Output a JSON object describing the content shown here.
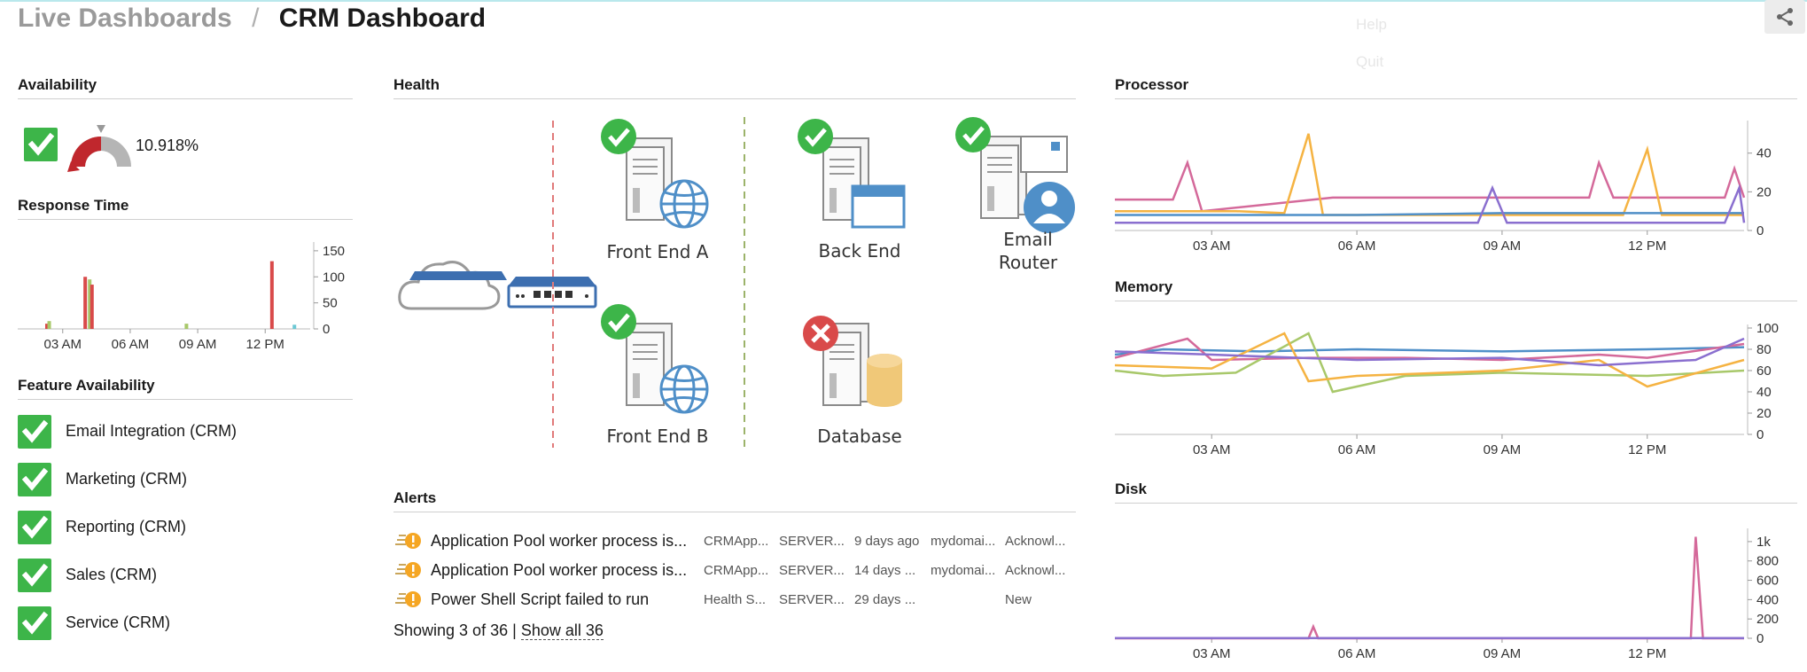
{
  "breadcrumb": {
    "root": "Live Dashboards",
    "separator": "/",
    "current": "CRM Dashboard"
  },
  "menu_ghost": {
    "help": "Help",
    "quit": "Quit"
  },
  "availability": {
    "title": "Availability",
    "value": "10.918%",
    "status_color": "#3db549",
    "gauge_color": "#c0272d"
  },
  "response_time": {
    "title": "Response Time"
  },
  "feature_availability": {
    "title": "Feature Availability",
    "items": [
      {
        "label": "Email Integration (CRM)"
      },
      {
        "label": "Marketing (CRM)"
      },
      {
        "label": "Reporting (CRM)"
      },
      {
        "label": "Sales (CRM)"
      },
      {
        "label": "Service (CRM)"
      }
    ]
  },
  "health": {
    "title": "Health",
    "nodes": [
      {
        "label": "Front End A",
        "status": "ok"
      },
      {
        "label": "Back End",
        "status": "ok"
      },
      {
        "label": "Email Router",
        "label_line1": "Email",
        "label_line2": "Router",
        "status": "ok"
      },
      {
        "label": "Front End B",
        "status": "ok"
      },
      {
        "label": "Database",
        "status": "error"
      }
    ]
  },
  "alerts": {
    "title": "Alerts",
    "rows": [
      {
        "name": "Application Pool worker process is...",
        "source": "CRMApp...",
        "server": "SERVER...",
        "age": "9 days ago",
        "domain": "mydomai...",
        "state": "Acknowl..."
      },
      {
        "name": "Application Pool worker process is...",
        "source": "CRMApp...",
        "server": "SERVER...",
        "age": "14 days ...",
        "domain": "mydomai...",
        "state": "Acknowl..."
      },
      {
        "name": "Power Shell Script failed to run",
        "source": "Health S...",
        "server": "SERVER...",
        "age": "29 days ...",
        "domain": "",
        "state": "New"
      }
    ],
    "showing_text": "Showing 3 of 36",
    "divider": "|",
    "show_all": "Show all 36"
  },
  "colors": {
    "pink": "#d4699a",
    "orange": "#f5b342",
    "blue": "#4f8fc8",
    "purple": "#8a6fcf",
    "green": "#a8c86a",
    "red": "#d94a4a"
  },
  "chart_data": [
    {
      "type": "bar",
      "title": "Response Time",
      "x_ticks": [
        "03 AM",
        "06 AM",
        "09 AM",
        "12 PM"
      ],
      "y_ticks": [
        "150",
        "100",
        "50",
        "0"
      ],
      "ylim": [
        0,
        160
      ],
      "x_range_hours": [
        1.0,
        14.0
      ],
      "series": [
        {
          "values": [
            [
              2.3,
              10
            ],
            [
              2.4,
              15
            ],
            [
              4.0,
              100
            ],
            [
              4.2,
              95
            ],
            [
              4.3,
              85
            ],
            [
              8.5,
              10
            ],
            [
              12.3,
              130
            ],
            [
              13.3,
              8
            ]
          ]
        }
      ]
    },
    {
      "type": "line",
      "title": "Processor",
      "x_ticks": [
        "03 AM",
        "06 AM",
        "09 AM",
        "12 PM"
      ],
      "y_ticks": [
        "40",
        "20",
        "0"
      ],
      "ylim": [
        0,
        55
      ],
      "x_range_hours": [
        1.0,
        14.0
      ],
      "series": [
        {
          "color": "#d4699a",
          "values": [
            [
              1.0,
              16
            ],
            [
              2.2,
              16
            ],
            [
              2.5,
              35
            ],
            [
              2.8,
              10
            ],
            [
              5.5,
              17
            ],
            [
              10.0,
              17
            ],
            [
              10.8,
              17
            ],
            [
              11.0,
              35
            ],
            [
              11.3,
              17
            ],
            [
              13.6,
              17
            ],
            [
              13.8,
              32
            ],
            [
              14.0,
              17
            ]
          ]
        },
        {
          "color": "#f5b342",
          "values": [
            [
              1.0,
              10
            ],
            [
              3.5,
              10
            ],
            [
              4.5,
              9
            ],
            [
              5.0,
              50
            ],
            [
              5.3,
              8
            ],
            [
              11.5,
              8
            ],
            [
              12.0,
              42
            ],
            [
              12.3,
              8
            ],
            [
              14.0,
              8
            ]
          ]
        },
        {
          "color": "#4f8fc8",
          "values": [
            [
              1.0,
              8
            ],
            [
              6.0,
              8
            ],
            [
              9.0,
              9
            ],
            [
              14.0,
              9
            ]
          ]
        },
        {
          "color": "#8a6fcf",
          "values": [
            [
              1.0,
              4
            ],
            [
              8.5,
              4
            ],
            [
              8.8,
              22
            ],
            [
              9.1,
              4
            ],
            [
              13.6,
              4
            ],
            [
              13.9,
              22
            ],
            [
              14.0,
              4
            ]
          ]
        }
      ]
    },
    {
      "type": "line",
      "title": "Memory",
      "x_ticks": [
        "03 AM",
        "06 AM",
        "09 AM",
        "12 PM"
      ],
      "y_ticks": [
        "100",
        "80",
        "60",
        "40",
        "20",
        "0"
      ],
      "ylim": [
        0,
        100
      ],
      "x_range_hours": [
        1.0,
        14.0
      ],
      "series": [
        {
          "color": "#4f8fc8",
          "values": [
            [
              1.0,
              75
            ],
            [
              2.0,
              80
            ],
            [
              4.0,
              78
            ],
            [
              6.0,
              80
            ],
            [
              9.0,
              78
            ],
            [
              12.0,
              80
            ],
            [
              14.0,
              82
            ]
          ]
        },
        {
          "color": "#d4699a",
          "values": [
            [
              1.0,
              72
            ],
            [
              2.5,
              90
            ],
            [
              3.0,
              70
            ],
            [
              5.0,
              72
            ],
            [
              7.0,
              72
            ],
            [
              9.0,
              70
            ],
            [
              11.0,
              75
            ],
            [
              12.0,
              72
            ],
            [
              14.0,
              85
            ]
          ]
        },
        {
          "color": "#a8c86a",
          "values": [
            [
              1.0,
              60
            ],
            [
              2.0,
              55
            ],
            [
              3.5,
              58
            ],
            [
              5.0,
              95
            ],
            [
              5.5,
              40
            ],
            [
              7.0,
              55
            ],
            [
              9.0,
              58
            ],
            [
              12.0,
              55
            ],
            [
              14.0,
              60
            ]
          ]
        },
        {
          "color": "#f5b342",
          "values": [
            [
              1.0,
              65
            ],
            [
              3.0,
              62
            ],
            [
              4.5,
              95
            ],
            [
              5.0,
              50
            ],
            [
              6.0,
              55
            ],
            [
              9.0,
              60
            ],
            [
              11.0,
              70
            ],
            [
              12.0,
              45
            ],
            [
              14.0,
              70
            ]
          ]
        },
        {
          "color": "#8a6fcf",
          "values": [
            [
              1.0,
              78
            ],
            [
              3.0,
              75
            ],
            [
              6.0,
              70
            ],
            [
              9.0,
              72
            ],
            [
              11.0,
              65
            ],
            [
              13.0,
              70
            ],
            [
              14.0,
              90
            ]
          ]
        }
      ]
    },
    {
      "type": "line",
      "title": "Disk",
      "x_ticks": [
        "03 AM",
        "06 AM",
        "09 AM",
        "12 PM"
      ],
      "y_ticks": [
        "1k",
        "800",
        "600",
        "400",
        "200",
        "0"
      ],
      "ylim": [
        0,
        1100
      ],
      "x_range_hours": [
        1.0,
        14.0
      ],
      "series": [
        {
          "color": "#d4699a",
          "values": [
            [
              1.0,
              0
            ],
            [
              5.0,
              0
            ],
            [
              5.1,
              120
            ],
            [
              5.2,
              0
            ],
            [
              12.9,
              0
            ],
            [
              13.0,
              1050
            ],
            [
              13.15,
              0
            ],
            [
              14.0,
              0
            ]
          ]
        },
        {
          "color": "#8a6fcf",
          "values": [
            [
              1.0,
              2
            ],
            [
              14.0,
              2
            ]
          ]
        }
      ]
    }
  ]
}
